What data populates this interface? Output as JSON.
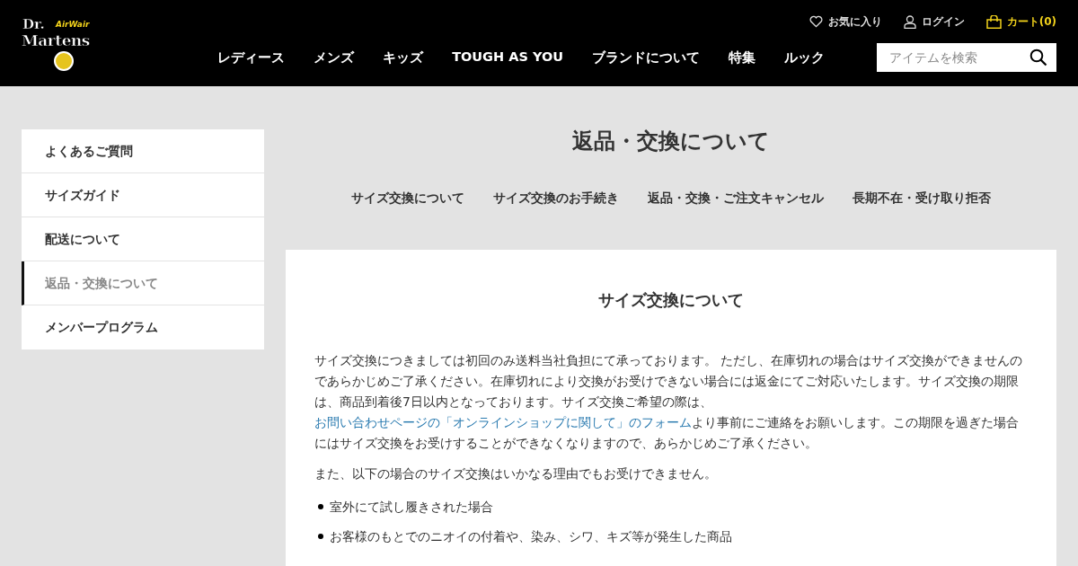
{
  "header": {
    "logo": {
      "brand_top": "Dr.",
      "brand_main": "Martens",
      "brand_sub": "AirWair"
    },
    "utility_links": [
      {
        "kind": "favorites",
        "label": "お気に入り"
      },
      {
        "kind": "login",
        "label": "ログイン"
      },
      {
        "kind": "cart",
        "label": "カート(0)"
      }
    ],
    "nav": [
      "レディース",
      "メンズ",
      "キッズ",
      "TOUGH AS YOU",
      "ブランドについて",
      "特集",
      "ルック"
    ],
    "search": {
      "placeholder": "アイテムを検索"
    }
  },
  "sidebar": {
    "items": [
      {
        "label": "よくあるご質問",
        "selected": false
      },
      {
        "label": "サイズガイド",
        "selected": false
      },
      {
        "label": "配送について",
        "selected": false
      },
      {
        "label": "返品・交換について",
        "selected": true
      },
      {
        "label": "メンバープログラム",
        "selected": false
      }
    ]
  },
  "page_title": "返品・交換について",
  "sub_nav": [
    "サイズ交換について",
    "サイズ交換のお手続き",
    "返品・交換・ご注文キャンセル",
    "長期不在・受け取り拒否"
  ],
  "section": {
    "heading": "サイズ交換について",
    "paragraph": {
      "before": "サイズ交換につきましては初回のみ送料当社負担にて承っております。 ただし、在庫切れの場合はサイズ交換ができませんのであらかじめご了承ください。在庫切れにより交換がお受けできない場合には返金にてご対応いたします。サイズ交換の期限は、商品到着後7日以内となっております。サイズ交換ご希望の際は、",
      "link": "お問い合わせページの「オンラインショップに関して」のフォーム",
      "after": "より事前にご連絡をお願いします。この期限を過ぎた場合にはサイズ交換をお受けすることができなくなりますので、あらかじめご了承ください。"
    },
    "note": "また、以下の場合のサイズ交換はいかなる理由でもお受けできません。",
    "bullets": [
      "室外にて試し履きされた場合",
      "お客様のもとでのニオイの付着や、染み、シワ、キズ等が発生した商品"
    ]
  }
}
